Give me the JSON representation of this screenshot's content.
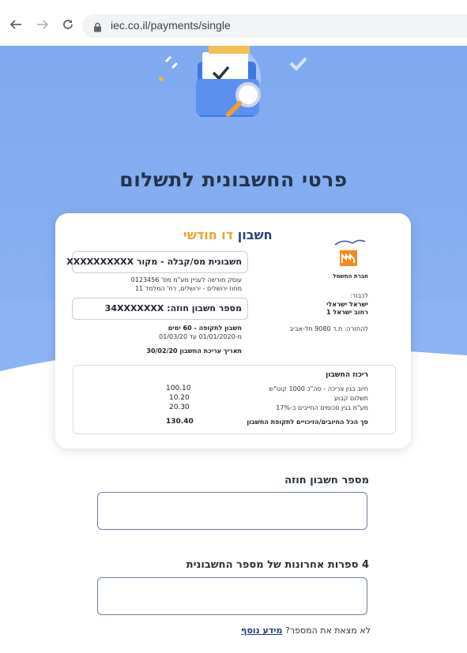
{
  "browser": {
    "url": "iec.co.il/payments/single",
    "back_icon": "arrow-left-icon",
    "forward_icon": "arrow-right-icon",
    "reload_icon": "reload-icon",
    "lock_icon": "lock-icon"
  },
  "hero": {
    "title": "פרטי החשבונית לתשלום",
    "illustration": "folder-magnifier-icon",
    "bg_color": "#8cb3f4"
  },
  "bill": {
    "heading_part1": "חשבון",
    "heading_part2": "דו חודשי",
    "invoice_box": "חשבונית מס/קבלה - מקור  XXXXXXXXXX",
    "dealer_line": "עוסק מורשה לעניין מע\"מ מס' 0123456",
    "address_line": "מחוז ירושלים - ירושלים, רח' המלמד 11",
    "account_box": "מספר חשבון חוזה:  34XXXXXXX",
    "period_label": "חשבון לתקופה - 60 ימים",
    "period_range": "מ-01/01/2020 עד 01/03/20",
    "issue_date": "תאריך עריכת החשבון   30/02/20",
    "logo_caption": "חברת החשמל",
    "to_label": "לכבוד:",
    "to_name": "ישראל ישראלי",
    "to_street": "רחוב ישראל 1",
    "return_address": "להחזרה: ת.ד 9080 תל-אביב",
    "summary": {
      "title": "ריכוז החשבון",
      "rows": [
        {
          "label": "חיוב בגין צריכה - סה\"כ 1000 קוט\"ש",
          "value": "100.10"
        },
        {
          "label": "תשלום קבוע",
          "value": "10.20"
        },
        {
          "label": "מע\"מ בגין סכומים החייבים ב-17%",
          "value": "20.30"
        }
      ],
      "total_label": "סך הכל החיובים/הזיכויים לתקופת החשבון",
      "total_value": "130.40"
    }
  },
  "form": {
    "contract_label": "מספר חשבון חוזה",
    "contract_value": "",
    "card_digits_label": "4 ספרות אחרונות של מספר החשבונית",
    "card_digits_value": "",
    "help_text": "לא מצאת את המספר?",
    "help_link": "מידע נוסף"
  }
}
